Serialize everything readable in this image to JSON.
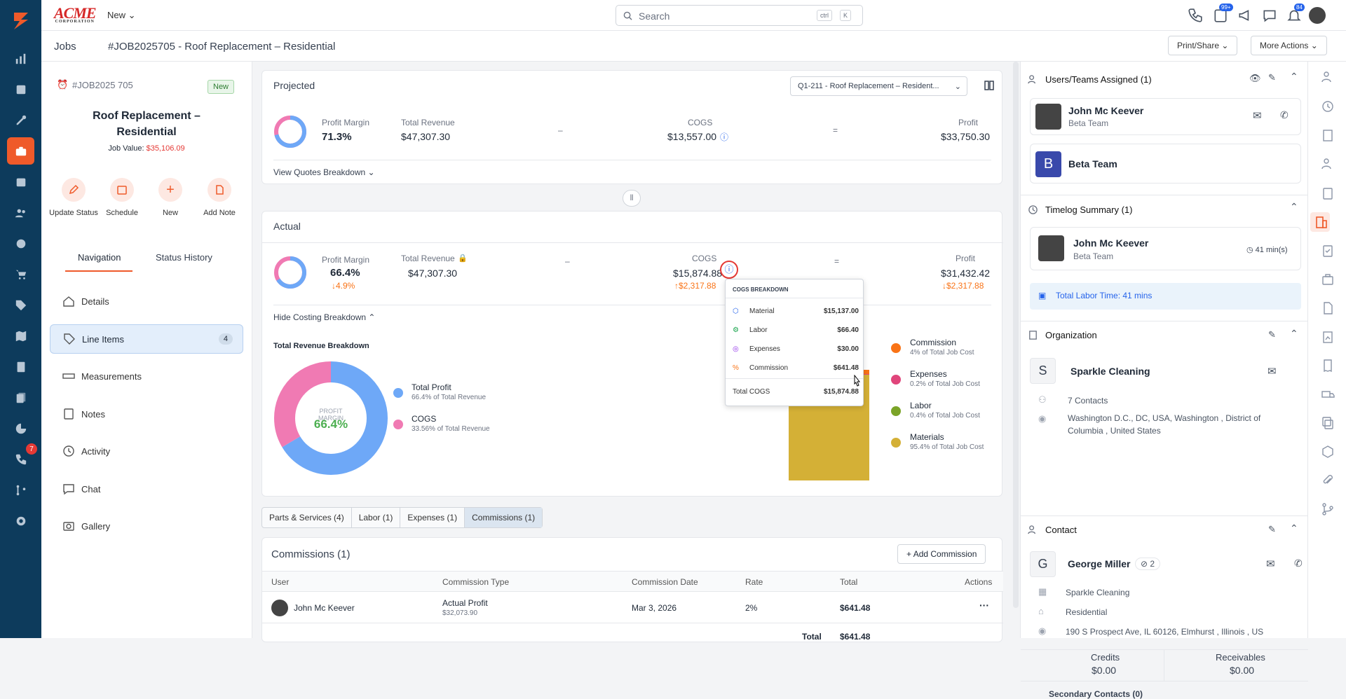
{
  "topbar": {
    "brand": "ACME",
    "brand_sub": "CORPORATION",
    "new_label": "New",
    "search_placeholder": "Search",
    "kbd1": "ctrl",
    "kbd2": "K",
    "tasks_badge": "99+",
    "bell_badge": "84"
  },
  "crumb": {
    "jobs": "Jobs",
    "title": "#JOB2025705 - Roof Replacement – Residential",
    "print": "Print/Share",
    "more": "More Actions"
  },
  "job": {
    "number": "#JOB2025 705",
    "status": "New",
    "title": "Roof Replacement – Residential",
    "value_label": "Job Value:",
    "value": "$35,106.09"
  },
  "actions": [
    "Update Status",
    "Schedule",
    "New",
    "Add Note"
  ],
  "navtabs": {
    "nav": "Navigation",
    "history": "Status History"
  },
  "nav": [
    {
      "label": "Details"
    },
    {
      "label": "Line Items",
      "count": "4"
    },
    {
      "label": "Measurements"
    },
    {
      "label": "Notes"
    },
    {
      "label": "Activity"
    },
    {
      "label": "Chat"
    },
    {
      "label": "Gallery"
    }
  ],
  "rail_badge": "7",
  "projected": {
    "title": "Projected",
    "quote": "Q1-211 - Roof Replacement – Resident...",
    "pm_label": "Profit Margin",
    "pm": "71.3%",
    "rev_label": "Total Revenue",
    "rev": "$47,307.30",
    "minus": "–",
    "cogs_label": "COGS",
    "cogs": "$13,557.00",
    "eq": "=",
    "profit_label": "Profit",
    "profit": "$33,750.30",
    "link": "View Quotes Breakdown"
  },
  "actual": {
    "title": "Actual",
    "pm_label": "Profit Margin",
    "pm": "66.4%",
    "pm_delta": "4.9%",
    "rev_label": "Total Revenue",
    "rev": "$47,307.30",
    "minus": "–",
    "cogs_label": "COGS",
    "cogs": "$15,874.88",
    "cogs_delta": "$2,317.88",
    "eq": "=",
    "profit_label": "Profit",
    "profit": "$31,432.42",
    "profit_delta": "$2,317.88",
    "link": "Hide Costing Breakdown",
    "breakdown_title": "Total Revenue Breakdown",
    "donut_label": "PROFIT MARGIN",
    "donut_value": "66.4%"
  },
  "chart_data": [
    {
      "type": "pie",
      "title": "Total Revenue Breakdown",
      "labels": [
        "Total Profit",
        "COGS"
      ],
      "values": [
        66.4,
        33.56
      ],
      "notes": [
        "66.4% of Total Revenue",
        "33.56% of Total Revenue"
      ],
      "colors": [
        "#6ea8f7",
        "#f07ab3"
      ]
    },
    {
      "type": "bar",
      "categories": [
        "Commission",
        "Expenses",
        "Labor",
        "Materials"
      ],
      "values": [
        4,
        0.2,
        0.4,
        95.4
      ],
      "notes": [
        "4% of Total Job Cost",
        "0.2% of Total Job Cost",
        "0.4% of Total Job Cost",
        "95.4% of Total Job Cost"
      ],
      "colors": [
        "#f97316",
        "#e0457b",
        "#7ba428",
        "#d4b036"
      ]
    }
  ],
  "tooltip": {
    "title": "COGS BREAKDOWN",
    "rows": [
      {
        "label": "Material",
        "value": "$15,137.00"
      },
      {
        "label": "Labor",
        "value": "$66.40"
      },
      {
        "label": "Expenses",
        "value": "$30.00"
      },
      {
        "label": "Commission",
        "value": "$641.48"
      }
    ],
    "total_label": "Total COGS",
    "total": "$15,874.88"
  },
  "tabs": [
    "Parts & Services (4)",
    "Labor (1)",
    "Expenses (1)",
    "Commissions (1)"
  ],
  "commissions": {
    "title": "Commissions (1)",
    "add": "Add Commission",
    "headers": [
      "User",
      "Commission Type",
      "Commission Date",
      "Rate",
      "Total",
      "Actions"
    ],
    "row": {
      "user": "John Mc Keever",
      "type": "Actual Profit",
      "type_sub": "$32,073.90",
      "date": "Mar 3, 2026",
      "rate": "2%",
      "total": "$641.48",
      "more": "···"
    },
    "total_label": "Total",
    "total": "$641.48"
  },
  "right": {
    "assigned_title": "Users/Teams Assigned (1)",
    "user_name": "John Mc Keever",
    "user_team": "Beta Team",
    "team_initial": "B",
    "team_name": "Beta Team",
    "timelog_title": "Timelog Summary (1)",
    "tl_name": "John Mc Keever",
    "tl_team": "Beta Team",
    "tl_time": "41 min(s)",
    "labor_total": "Total Labor Time: 41 mins",
    "org_title": "Organization",
    "org_initial": "S",
    "org_name": "Sparkle Cleaning",
    "org_contacts": "7 Contacts",
    "org_address": "Washington D.C., DC, USA, Washington , District of Columbia , United States",
    "contact_title": "Contact",
    "contact_initial": "G",
    "contact_name": "George Miller",
    "contact_count": "2",
    "contact_company": "Sparkle Cleaning",
    "contact_type": "Residential",
    "contact_address": "190 S Prospect Ave, IL 60126, Elmhurst , Illinois , US",
    "credits_label": "Credits",
    "credits": "$0.00",
    "recv_label": "Receivables",
    "recv": "$0.00",
    "secondary": "Secondary Contacts (0)"
  }
}
